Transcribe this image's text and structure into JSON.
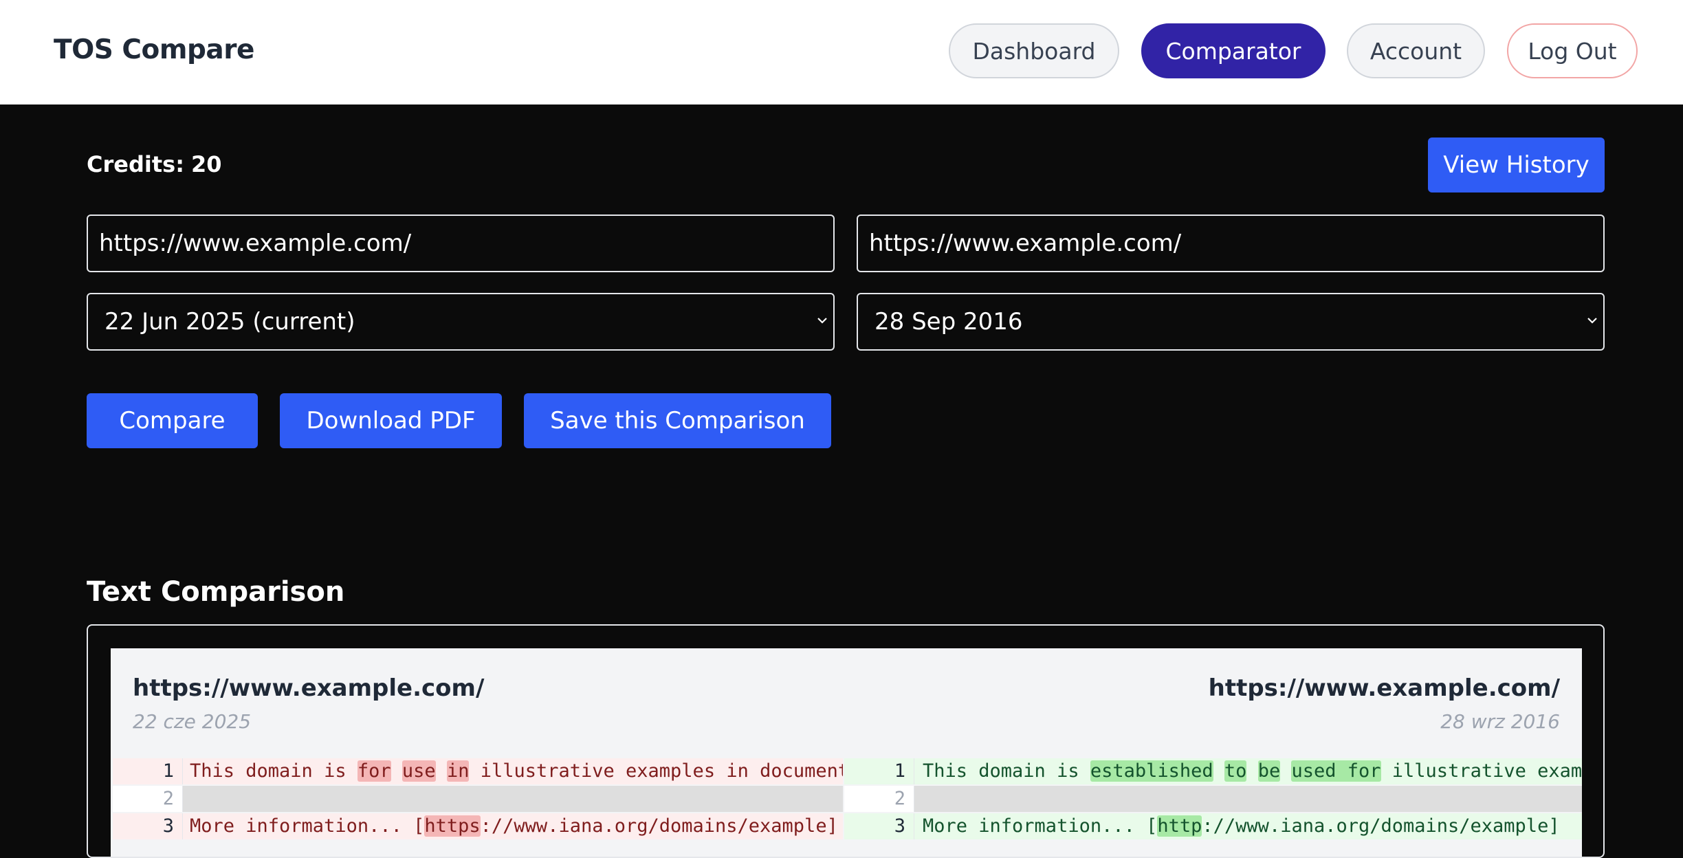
{
  "app": {
    "title": "TOS Compare"
  },
  "nav": {
    "dashboard": "Dashboard",
    "comparator": "Comparator",
    "account": "Account",
    "logout": "Log Out"
  },
  "credits": {
    "label": "Credits:",
    "value": "20"
  },
  "history_button": "View History",
  "left": {
    "url_value": "https://www.example.com/",
    "date_value": "22 Jun 2025 (current)"
  },
  "right": {
    "url_value": "https://www.example.com/",
    "date_value": "28 Sep 2016"
  },
  "actions": {
    "compare": "Compare",
    "download_pdf": "Download PDF",
    "save": "Save this Comparison"
  },
  "section_title": "Text Comparison",
  "diff": {
    "left_url": "https://www.example.com/",
    "left_date": "22 cze 2025",
    "right_url": "https://www.example.com/",
    "right_date": "28 wrz 2016",
    "rows": [
      {
        "left_num": "1",
        "left_segments": [
          {
            "t": "This domain is ",
            "h": false
          },
          {
            "t": "for",
            "h": true
          },
          {
            "t": " ",
            "h": false
          },
          {
            "t": "use",
            "h": true
          },
          {
            "t": " ",
            "h": false
          },
          {
            "t": "in",
            "h": true
          },
          {
            "t": " illustrative examples in documents.",
            "h": false
          }
        ],
        "right_num": "1",
        "right_segments": [
          {
            "t": "This domain is ",
            "h": false
          },
          {
            "t": "established",
            "h": true
          },
          {
            "t": " ",
            "h": false
          },
          {
            "t": "to",
            "h": true
          },
          {
            "t": " ",
            "h": false
          },
          {
            "t": "be",
            "h": true
          },
          {
            "t": " ",
            "h": false
          },
          {
            "t": "used for",
            "h": true
          },
          {
            "t": " illustrative exampl",
            "h": false
          }
        ]
      },
      {
        "left_num": "2",
        "left_segments": [],
        "right_num": "2",
        "right_segments": []
      },
      {
        "left_num": "3",
        "left_segments": [
          {
            "t": "More information... [",
            "h": false
          },
          {
            "t": "https",
            "h": true
          },
          {
            "t": "://www.iana.org/domains/example]",
            "h": false
          }
        ],
        "right_num": "3",
        "right_segments": [
          {
            "t": "More information... [",
            "h": false
          },
          {
            "t": "http",
            "h": true
          },
          {
            "t": "://www.iana.org/domains/example]",
            "h": false
          }
        ]
      }
    ]
  }
}
